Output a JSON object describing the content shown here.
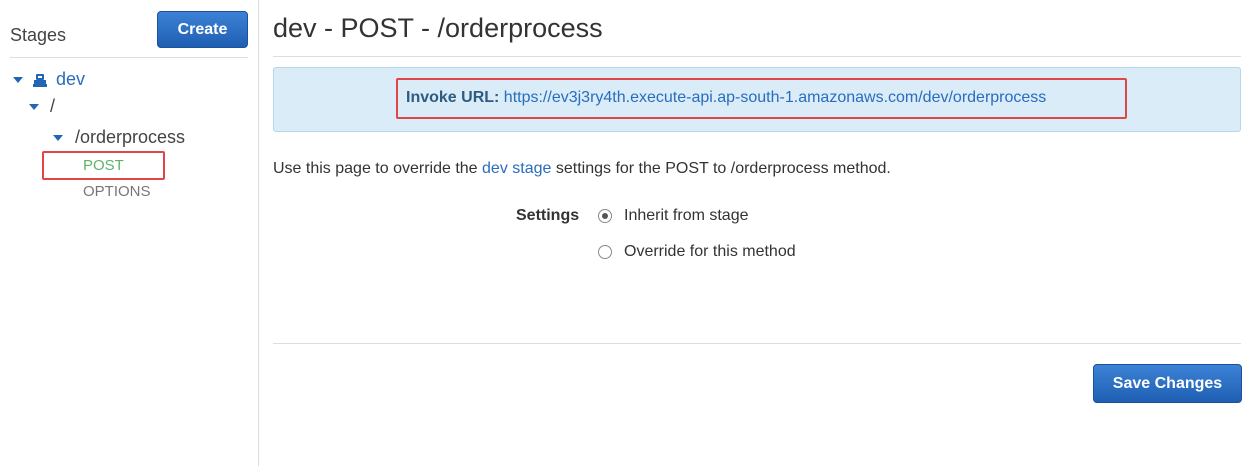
{
  "sidebar": {
    "title": "Stages",
    "create_label": "Create",
    "tree": {
      "stage": "dev",
      "root": "/",
      "resource": "/orderprocess",
      "methods": [
        "POST",
        "OPTIONS"
      ],
      "selected_method": "POST"
    }
  },
  "main": {
    "title": "dev - POST - /orderprocess",
    "invoke": {
      "label": "Invoke URL:",
      "url": "https://ev3j3ry4th.execute-api.ap-south-1.amazonaws.com/dev/orderprocess"
    },
    "description": {
      "prefix": "Use this page to override the ",
      "link": "dev stage",
      "suffix": " settings for the POST to /orderprocess method."
    },
    "settings": {
      "label": "Settings",
      "options": [
        "Inherit from stage",
        "Override for this method"
      ],
      "selected": "Inherit from stage"
    },
    "save_label": "Save Changes"
  },
  "colors": {
    "accent": "#1f5fb3",
    "link": "#2a6cbf",
    "highlight": "#e04548",
    "post_method": "#5db36a",
    "invoke_bg": "#d9ecf7"
  },
  "icons": {
    "stage": "stage-icon",
    "expand": "chevron-down-icon"
  }
}
